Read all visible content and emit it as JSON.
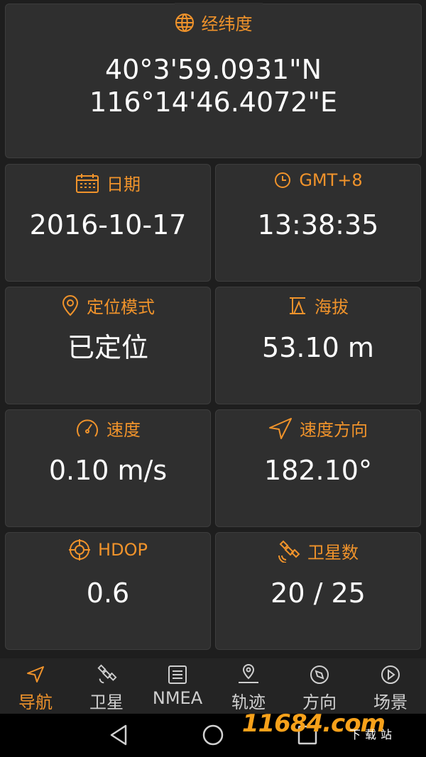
{
  "colors": {
    "accent": "#f0932b",
    "card_bg": "#2f2f2f",
    "screen_bg": "#1e1e1e",
    "text": "#ffffff"
  },
  "coordinates": {
    "title": "经纬度",
    "icon": "globe-icon",
    "latitude": "40°3'59.0931\"N",
    "longitude": "116°14'46.4072\"E"
  },
  "date": {
    "title": "日期",
    "icon": "calendar-icon",
    "value": "2016-10-17"
  },
  "time": {
    "title": "GMT+8",
    "icon": "clock-icon",
    "value": "13:38:35"
  },
  "fix_mode": {
    "title": "定位模式",
    "icon": "location-pin-icon",
    "value": "已定位"
  },
  "altitude": {
    "title": "海拔",
    "icon": "altitude-icon",
    "value": "53.10 m"
  },
  "speed": {
    "title": "速度",
    "icon": "speedometer-icon",
    "value": "0.10 m/s"
  },
  "heading": {
    "title": "速度方向",
    "icon": "navigation-arrow-icon",
    "value": "182.10°"
  },
  "hdop": {
    "title": "HDOP",
    "icon": "crosshair-icon",
    "value": "0.6"
  },
  "satellites": {
    "title": "卫星数",
    "icon": "satellite-icon",
    "value": "20 / 25"
  },
  "bottom_nav": {
    "items": [
      {
        "label": "导航",
        "icon": "navigation-icon",
        "active": true
      },
      {
        "label": "卫星",
        "icon": "satellite-icon",
        "active": false
      },
      {
        "label": "NMEA",
        "icon": "list-icon",
        "active": false
      },
      {
        "label": "轨迹",
        "icon": "track-pin-icon",
        "active": false
      },
      {
        "label": "方向",
        "icon": "compass-icon",
        "active": false
      },
      {
        "label": "场景",
        "icon": "play-icon",
        "active": false
      }
    ]
  },
  "watermark": {
    "brand": "11684.com",
    "sub": "下载站"
  }
}
